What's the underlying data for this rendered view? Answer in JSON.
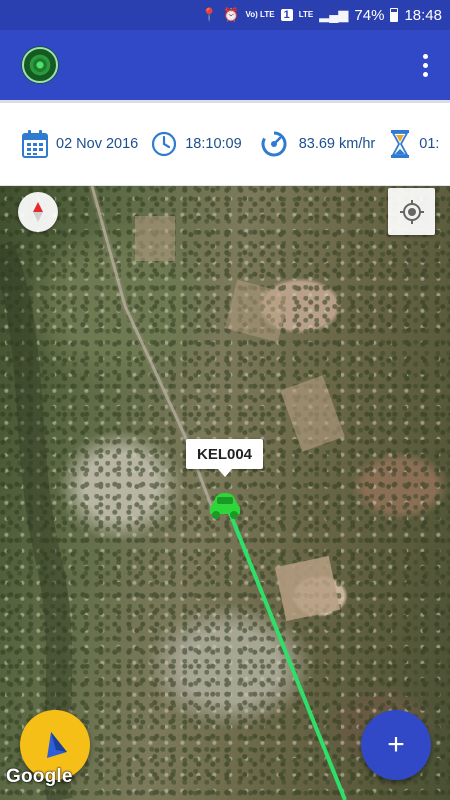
{
  "status_bar": {
    "battery_percent": "74%",
    "time": "18:48",
    "network_label": "LTE",
    "volte_label": "Vo) LTE",
    "sim_slot": "1"
  },
  "app_bar": {
    "logo_icon": "radar-icon",
    "menu_icon": "more-vert-icon"
  },
  "info_bar": {
    "date": "02 Nov 2016",
    "time": "18:10:09",
    "speed": "83.69 km/hr",
    "duration": "01:"
  },
  "map": {
    "vehicle_label": "KEL004",
    "attribution": "Google",
    "compass_icon": "compass-icon",
    "locate_icon": "my-location-icon",
    "route_color": "#2ee06a",
    "vehicle_color": "#2fd63a"
  },
  "fabs": {
    "navigation_icon": "navigation-arrow-icon",
    "add_label": "+"
  },
  "colors": {
    "primary": "#3249c7",
    "status_bar": "#2a3fb0",
    "accent": "#f6bf17",
    "info_text": "#1d4f8f"
  }
}
